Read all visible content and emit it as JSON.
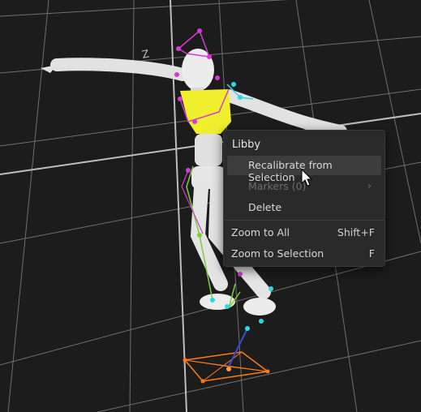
{
  "viewport": {
    "axis_label": "Z"
  },
  "context_menu": {
    "title": "Libby",
    "items": [
      {
        "label": "Recalibrate from Selection",
        "shortcut": "",
        "state": "highlighted"
      },
      {
        "label": "Markers (0)",
        "shortcut": "",
        "state": "disabled",
        "submenu": true
      },
      {
        "label": "Delete",
        "shortcut": "",
        "state": "normal"
      },
      {
        "label": "Zoom to All",
        "shortcut": "Shift+F",
        "state": "normal"
      },
      {
        "label": "Zoom to Selection",
        "shortcut": "F",
        "state": "normal"
      }
    ]
  },
  "icons": {
    "submenu": "chevron-right-icon",
    "pointer": "mouse-cursor-icon"
  },
  "colors": {
    "background": "#1c1c1c",
    "grid": "#8a8a8a",
    "body": "#e8e8e8",
    "torso_selected": "#f0ef2e",
    "marker_magenta": "#d63ad6",
    "marker_cyan": "#2ad8e8",
    "bone_green": "#7ccf3a",
    "force_plate": "#ff7a1a",
    "menu_bg": "#2a2a2a"
  }
}
